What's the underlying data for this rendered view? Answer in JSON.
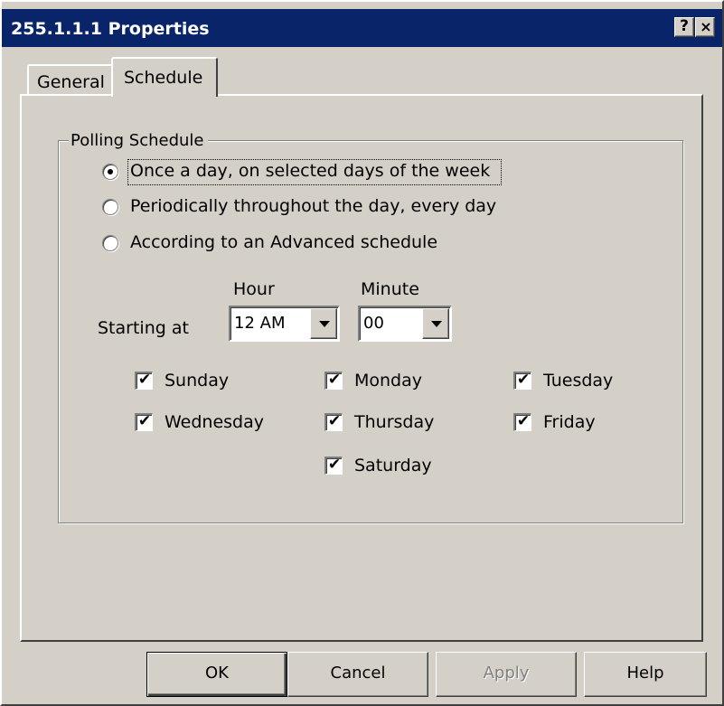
{
  "window": {
    "title": "255.1.1.1 Properties",
    "help_button": "?",
    "close_button": "×"
  },
  "tabs": [
    {
      "label": "General",
      "active": false
    },
    {
      "label": "Schedule",
      "active": true
    }
  ],
  "polling": {
    "group_label": "Polling Schedule",
    "options": [
      {
        "label": "Once a day, on selected days of the week",
        "selected": true
      },
      {
        "label": "Periodically throughout the day, every day",
        "selected": false
      },
      {
        "label": "According to an Advanced schedule",
        "selected": false
      }
    ],
    "starting_at_label": "Starting at",
    "hour_label": "Hour",
    "minute_label": "Minute",
    "hour_value": "12 AM",
    "minute_value": "00"
  },
  "days": [
    {
      "label": "Sunday",
      "checked": true
    },
    {
      "label": "Monday",
      "checked": true
    },
    {
      "label": "Tuesday",
      "checked": true
    },
    {
      "label": "Wednesday",
      "checked": true
    },
    {
      "label": "Thursday",
      "checked": true
    },
    {
      "label": "Friday",
      "checked": true
    },
    {
      "label": "Saturday",
      "checked": true
    }
  ],
  "check_glyph": "✔",
  "buttons": {
    "ok": "OK",
    "cancel": "Cancel",
    "apply": "Apply",
    "help": "Help"
  },
  "colors": {
    "titlebar": "#0a246a",
    "face": "#d4d0c8",
    "disabled_text": "#808080"
  }
}
